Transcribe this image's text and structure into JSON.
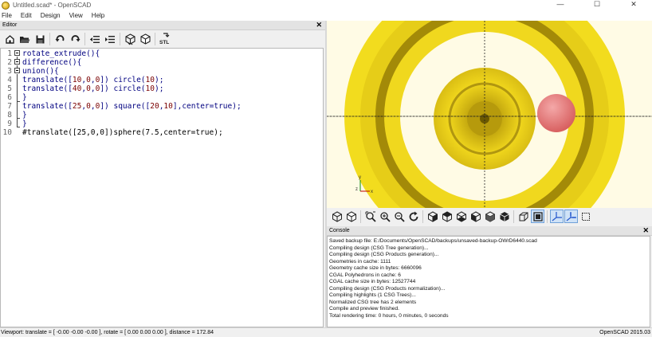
{
  "window": {
    "title": "Untitled.scad* - OpenSCAD",
    "minimize": "—",
    "maximize": "☐",
    "close": "✕"
  },
  "menu": [
    "File",
    "Edit",
    "Design",
    "View",
    "Help"
  ],
  "editor": {
    "title": "Editor",
    "close": "✕",
    "toolbar_icons": [
      "new-icon",
      "open-icon",
      "save-icon",
      "undo-icon",
      "redo-icon",
      "unindent-icon",
      "indent-icon",
      "preview-icon",
      "render-icon",
      "export-stl-icon"
    ],
    "stl_label": "STL",
    "lines": [
      {
        "n": "1",
        "tokens": [
          [
            "kw",
            "rotate_extrude(){"
          ]
        ]
      },
      {
        "n": "2",
        "tokens": [
          [
            "kw",
            "difference(){"
          ]
        ]
      },
      {
        "n": "3",
        "tokens": [
          [
            "kw",
            "union(){"
          ]
        ]
      },
      {
        "n": "4",
        "tokens": [
          [
            "kw",
            "translate(["
          ],
          [
            "num",
            "10"
          ],
          [
            "kw",
            ","
          ],
          [
            "num",
            "0"
          ],
          [
            "kw",
            ","
          ],
          [
            "num",
            "0"
          ],
          [
            "kw",
            "]) circle("
          ],
          [
            "num",
            "10"
          ],
          [
            "kw",
            ");"
          ]
        ]
      },
      {
        "n": "5",
        "tokens": [
          [
            "kw",
            "translate(["
          ],
          [
            "num",
            "40"
          ],
          [
            "kw",
            ","
          ],
          [
            "num",
            "0"
          ],
          [
            "kw",
            ","
          ],
          [
            "num",
            "0"
          ],
          [
            "kw",
            "]) circle("
          ],
          [
            "num",
            "10"
          ],
          [
            "kw",
            ");"
          ]
        ]
      },
      {
        "n": "6",
        "tokens": [
          [
            "kw",
            "}"
          ]
        ]
      },
      {
        "n": "7",
        "tokens": [
          [
            "kw",
            "translate(["
          ],
          [
            "num",
            "25"
          ],
          [
            "kw",
            ","
          ],
          [
            "num",
            "0"
          ],
          [
            "kw",
            ","
          ],
          [
            "num",
            "0"
          ],
          [
            "kw",
            "]) square(["
          ],
          [
            "num",
            "20"
          ],
          [
            "kw",
            ","
          ],
          [
            "num",
            "10"
          ],
          [
            "kw",
            "],center="
          ],
          [
            "bool",
            "true"
          ],
          [
            "kw",
            ");"
          ]
        ]
      },
      {
        "n": "8",
        "tokens": [
          [
            "kw",
            "}"
          ]
        ]
      },
      {
        "n": "9",
        "tokens": [
          [
            "kw",
            "}"
          ]
        ]
      },
      {
        "n": "10",
        "tokens": [
          [
            "cm",
            "#translate([25,0,0])sphere(7.5,center=true);"
          ]
        ]
      }
    ]
  },
  "viewport": {
    "background": "#fffbe5",
    "torus_color": "#f2dc1e",
    "highlight_sphere_color": "#ee8080",
    "axes_label_z": "z",
    "axes_label_y": "y",
    "axes_label_x": "x"
  },
  "view_toolbar_icons": [
    "preview-icon",
    "surfaces-icon",
    "zoom-all-icon",
    "zoom-in-icon",
    "zoom-out-icon",
    "reset-view-icon",
    "view-right-icon",
    "view-top-icon",
    "view-bottom-icon",
    "view-left-icon",
    "view-front-icon",
    "view-back-icon",
    "perspective-icon",
    "orthogonal-icon",
    "axes-icon",
    "scale-markers-icon",
    "edges-icon"
  ],
  "console": {
    "title": "Console",
    "close": "✕",
    "lines": [
      "Saved backup file: E:/Documents/OpenSCAD/backups/unsaved-backup-OWrD6440.scad",
      "Compiling design (CSG Tree generation)...",
      "Compiling design (CSG Products generation)...",
      "Geometries in cache: 1111",
      "Geometry cache size in bytes: 6660096",
      "CGAL Polyhedrons in cache: 6",
      "CGAL cache size in bytes: 12527744",
      "Compiling design (CSG Products normalization)...",
      "Compiling highlights (1 CSG Trees)...",
      "Normalized CSG tree has 2 elements",
      "Compile and preview finished.",
      "Total rendering time: 0 hours, 0 minutes, 0 seconds"
    ]
  },
  "status": {
    "viewport": "Viewport: translate = [ -0.00 -0.00 -0.00 ], rotate = [ 0.00 0.00 0.00 ], distance = 172.84",
    "version": "OpenSCAD 2015.03"
  }
}
